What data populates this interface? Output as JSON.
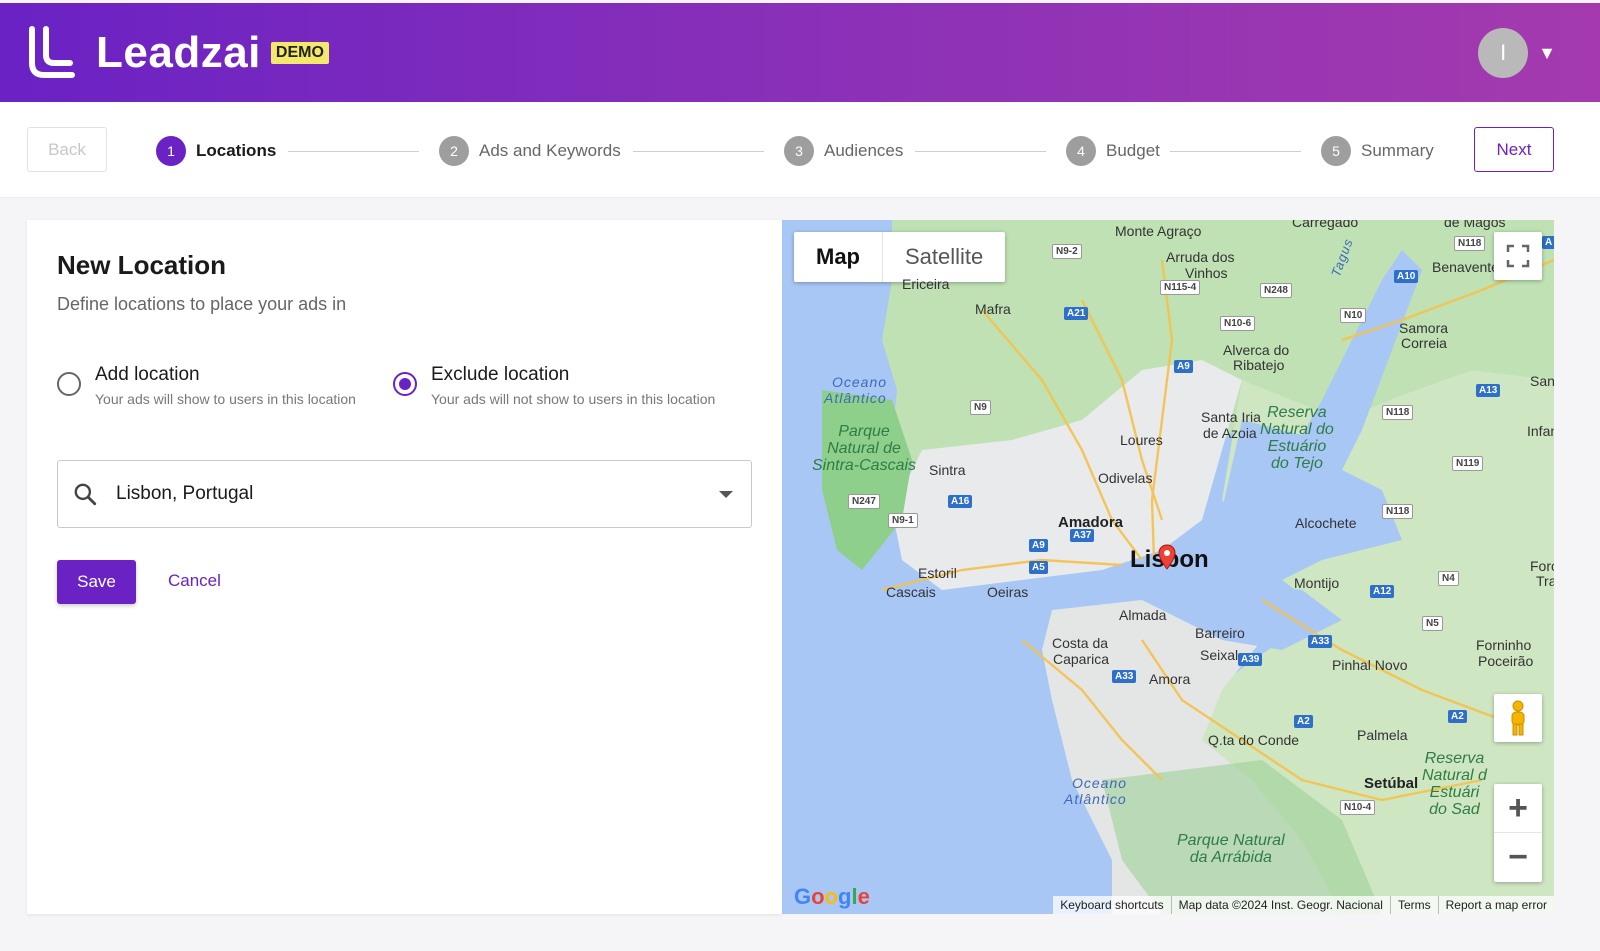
{
  "app": {
    "brand": "Leadzai",
    "badge": "DEMO",
    "avatar_initial": "I",
    "avatar_caret": "▼"
  },
  "nav": {
    "back_label": "Back",
    "next_label": "Next"
  },
  "steps": [
    {
      "num": "1",
      "label": "Locations",
      "active": true
    },
    {
      "num": "2",
      "label": "Ads and Keywords",
      "active": false
    },
    {
      "num": "3",
      "label": "Audiences",
      "active": false
    },
    {
      "num": "4",
      "label": "Budget",
      "active": false
    },
    {
      "num": "5",
      "label": "Summary",
      "active": false
    }
  ],
  "form": {
    "title": "New Location",
    "subtitle": "Define locations to place your ads in",
    "options": [
      {
        "label": "Add location",
        "desc": "Your ads will show to users in this location",
        "checked": false
      },
      {
        "label": "Exclude location",
        "desc": "Your ads will not show to users in this location",
        "checked": true
      }
    ],
    "search_value": "Lisbon, Portugal",
    "save_label": "Save",
    "cancel_label": "Cancel"
  },
  "map": {
    "type_map": "Map",
    "type_satellite": "Satellite",
    "logo": "Google",
    "attribution": [
      "Keyboard shortcuts",
      "Map data ©2024 Inst. Geogr. Nacional",
      "Terms",
      "Report a map error"
    ],
    "zoom_in": "+",
    "zoom_out": "−",
    "places": {
      "monte_agraco": "Monte Agraço",
      "arruda": "Arruda dos",
      "vinhos": "Vinhos",
      "mafra": "Mafra",
      "ericeira": "Ericeira",
      "benavente": "Benavente",
      "samora": "Samora",
      "correia": "Correia",
      "alverca": "Alverca do",
      "ribatejo": "Ribatejo",
      "oceano1": "Oceano",
      "atlantico1": "Atlântico",
      "santa_iria": "Santa Iria",
      "de_azoia": "de Azoia",
      "loures": "Loures",
      "sintra": "Sintra",
      "odivelas": "Odivelas",
      "amadora": "Amadora",
      "lisbon": "Lisbon",
      "alcochete": "Alcochete",
      "estoril": "Estoril",
      "cascais": "Cascais",
      "oeiras": "Oeiras",
      "almada": "Almada",
      "montijo": "Montijo",
      "barreiro": "Barreiro",
      "costa": "Costa da",
      "caparica": "Caparica",
      "seixal": "Seixal",
      "amora": "Amora",
      "pinhal_novo": "Pinhal Novo",
      "forninho": "Forninho",
      "poceirao": "Poceirão",
      "qta_conde": "Q.ta do Conde",
      "palmela": "Palmela",
      "setubal": "Setúbal",
      "oceano2": "Oceano",
      "atlantico2": "Atlântico",
      "santo_e": "Santo E",
      "infantad": "Infantad",
      "foros": "Foros",
      "tra": "Tra",
      "tagus": "Tagus",
      "carregado": "Carregado",
      "de_magos": "de Magos",
      "park_sintra": "Parque\nNatural de\nSintra-Cascais",
      "park_tejo": "Reserva\nNatural do\nEstuário\ndo Tejo",
      "park_arrabida": "Parque Natural\nda Arrábida",
      "park_sado": "Reserva\nNatural d\nEstuári\ndo Sad"
    },
    "roads": {
      "n9_2": "N9-2",
      "n115_4": "N115-4",
      "n248": "N248",
      "a21": "A21",
      "n10_6": "N10-6",
      "n10": "N10",
      "a10": "A10",
      "n118a": "N118",
      "a9a": "A9",
      "n9": "N9",
      "n118b": "N118",
      "a13": "A13",
      "n119": "N119",
      "n247": "N247",
      "a16": "A16",
      "n9_1": "N9-1",
      "a37": "A37",
      "a9b": "A9",
      "a5": "A5",
      "n118c": "N118",
      "a12": "A12",
      "n4": "N4",
      "n5": "N5",
      "a33a": "A33",
      "a39": "A39",
      "a33b": "A33",
      "a2a": "A2",
      "a2b": "A2",
      "n10_4": "N10-4",
      "a1": "A"
    }
  }
}
